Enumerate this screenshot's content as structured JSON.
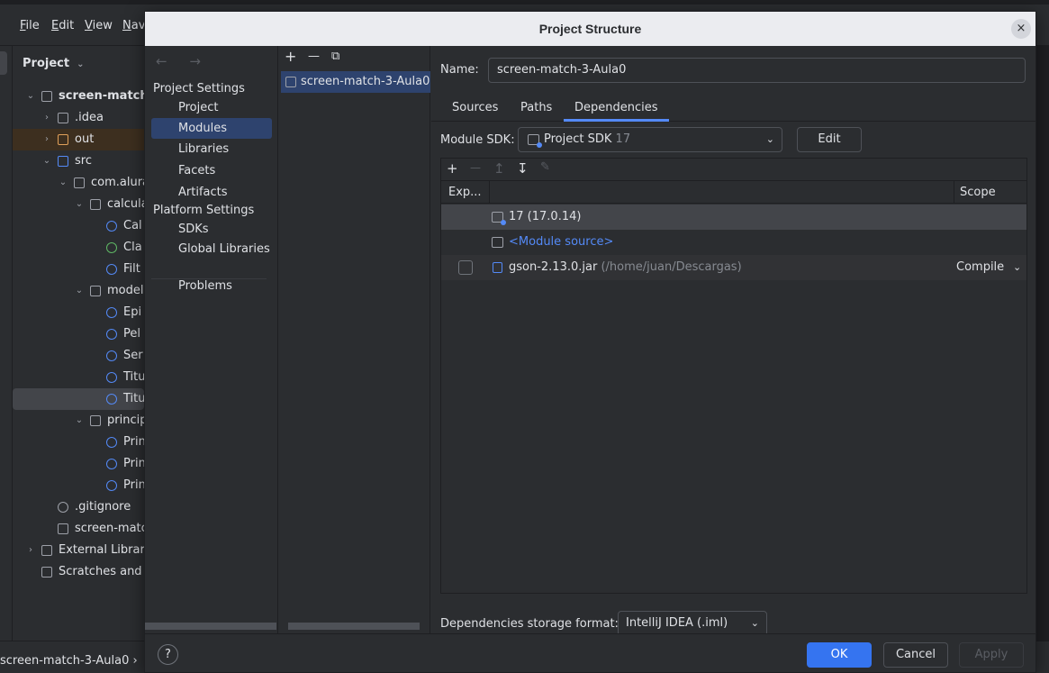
{
  "ide": {
    "menu": [
      "File",
      "Edit",
      "View",
      "Nav"
    ],
    "menu_mnemonics": [
      "F",
      "E",
      "V",
      "N"
    ],
    "project_panel_title": "Project",
    "tree": [
      {
        "label": "screen-match-",
        "type": "module",
        "expanded": true
      },
      {
        "label": ".idea",
        "type": "folder"
      },
      {
        "label": "out",
        "type": "folder-orange"
      },
      {
        "label": "src",
        "type": "folder-blue",
        "expanded": true
      },
      {
        "label": "com.alura",
        "type": "package",
        "expanded": true
      },
      {
        "label": "calcula",
        "type": "package",
        "expanded": true
      },
      {
        "label": "Cal",
        "type": "class"
      },
      {
        "label": "Cla",
        "type": "interface"
      },
      {
        "label": "Filt",
        "type": "class"
      },
      {
        "label": "model",
        "type": "package",
        "expanded": true
      },
      {
        "label": "Epi",
        "type": "class"
      },
      {
        "label": "Pel",
        "type": "class"
      },
      {
        "label": "Ser",
        "type": "class"
      },
      {
        "label": "Titu",
        "type": "class"
      },
      {
        "label": "Titu",
        "type": "class"
      },
      {
        "label": "princip",
        "type": "package",
        "expanded": true
      },
      {
        "label": "Prin",
        "type": "class"
      },
      {
        "label": "Prin",
        "type": "class"
      },
      {
        "label": "Prin",
        "type": "class"
      },
      {
        "label": ".gitignore",
        "type": "ignore"
      },
      {
        "label": "screen-matc",
        "type": "file"
      },
      {
        "label": "External Librari",
        "type": "library"
      },
      {
        "label": "Scratches and",
        "type": "scratch"
      }
    ],
    "status_breadcrumb": "screen-match-3-Aula0"
  },
  "dialog": {
    "title": "Project Structure",
    "close_icon": "×",
    "nav": {
      "back_forward": "← →",
      "project_settings_header": "Project Settings",
      "project_settings": [
        "Project",
        "Modules",
        "Libraries",
        "Facets",
        "Artifacts"
      ],
      "platform_settings_header": "Platform Settings",
      "platform_settings": [
        "SDKs",
        "Global Libraries"
      ],
      "problems": "Problems",
      "active": "Modules"
    },
    "modules": {
      "toolbar": {
        "add": "+",
        "remove": "—",
        "copy": "⧉"
      },
      "items": [
        "screen-match-3-Aula0"
      ]
    },
    "content": {
      "name_label": "Name:",
      "name_value": "screen-match-3-Aula0",
      "tabs": [
        "Sources",
        "Paths",
        "Dependencies"
      ],
      "active_tab": "Dependencies",
      "sdk_label": "Module SDK:",
      "sdk_value": "Project SDK",
      "sdk_version": "17",
      "edit_button": "Edit",
      "dep_toolbar": {
        "add": "+",
        "remove": "—",
        "up": "↥",
        "down": "↧",
        "edit": "✎"
      },
      "columns": {
        "export": "Exp...",
        "scope": "Scope"
      },
      "rows": [
        {
          "label": "17 (17.0.14)",
          "extra": "",
          "scope": ""
        },
        {
          "label": "<Module source>",
          "extra": "",
          "scope": ""
        },
        {
          "label": "gson-2.13.0.jar",
          "extra": "(/home/juan/Descargas)",
          "scope": "Compile"
        }
      ],
      "storage_label": "Dependencies storage format:",
      "storage_value": "IntelliJ IDEA (.iml)"
    },
    "footer": {
      "help": "?",
      "ok": "OK",
      "cancel": "Cancel",
      "apply": "Apply"
    }
  },
  "colors": {
    "accent": "#3574f0",
    "selection": "#2e436e",
    "link": "#548af7"
  }
}
